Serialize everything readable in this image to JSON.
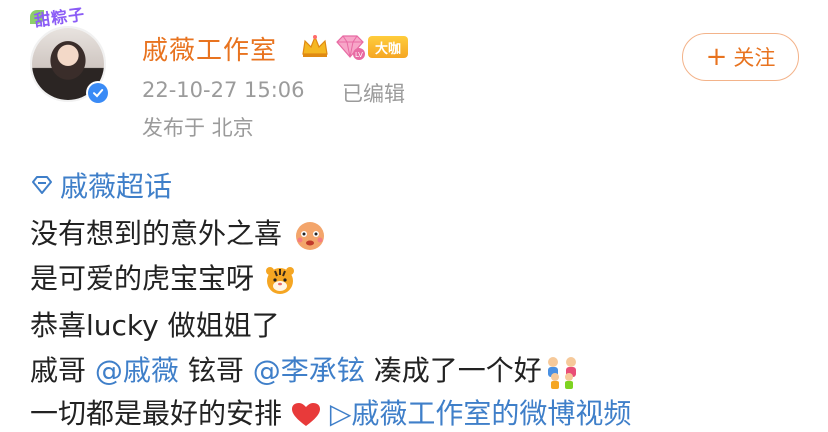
{
  "post": {
    "author_name": "戚薇工作室",
    "avatar_deco_text": "甜粽子",
    "badge_big": "大咖",
    "timestamp": "22-10-27 15:06",
    "edited_label": "已编辑",
    "location": "发布于 北京",
    "follow_plus": "+",
    "follow_label": "关注",
    "topic": "戚薇超话",
    "lines": {
      "l1": "没有想到的意外之喜",
      "l2": "是可爱的虎宝宝呀",
      "l3": "恭喜lucky 做姐姐了",
      "l4_a": "戚哥",
      "l4_m1": "@戚薇",
      "l4_b": "铉哥",
      "l4_m2": "@李承铉",
      "l4_c": "凑成了一个好",
      "l5_a": "一切都是最好的安排",
      "l5_link": "▷戚薇工作室的微博视频"
    }
  },
  "colors": {
    "accent_orange": "#e8731f",
    "link_blue": "#3f7fc9",
    "meta_gray": "#9b9b9b",
    "verified_blue": "#3a8bf6"
  },
  "icons": [
    "crown-icon",
    "diamond-level-icon",
    "verified-icon",
    "super-topic-icon",
    "blush-face-emoji",
    "tiger-emoji",
    "family-emoji",
    "heart-emoji"
  ]
}
